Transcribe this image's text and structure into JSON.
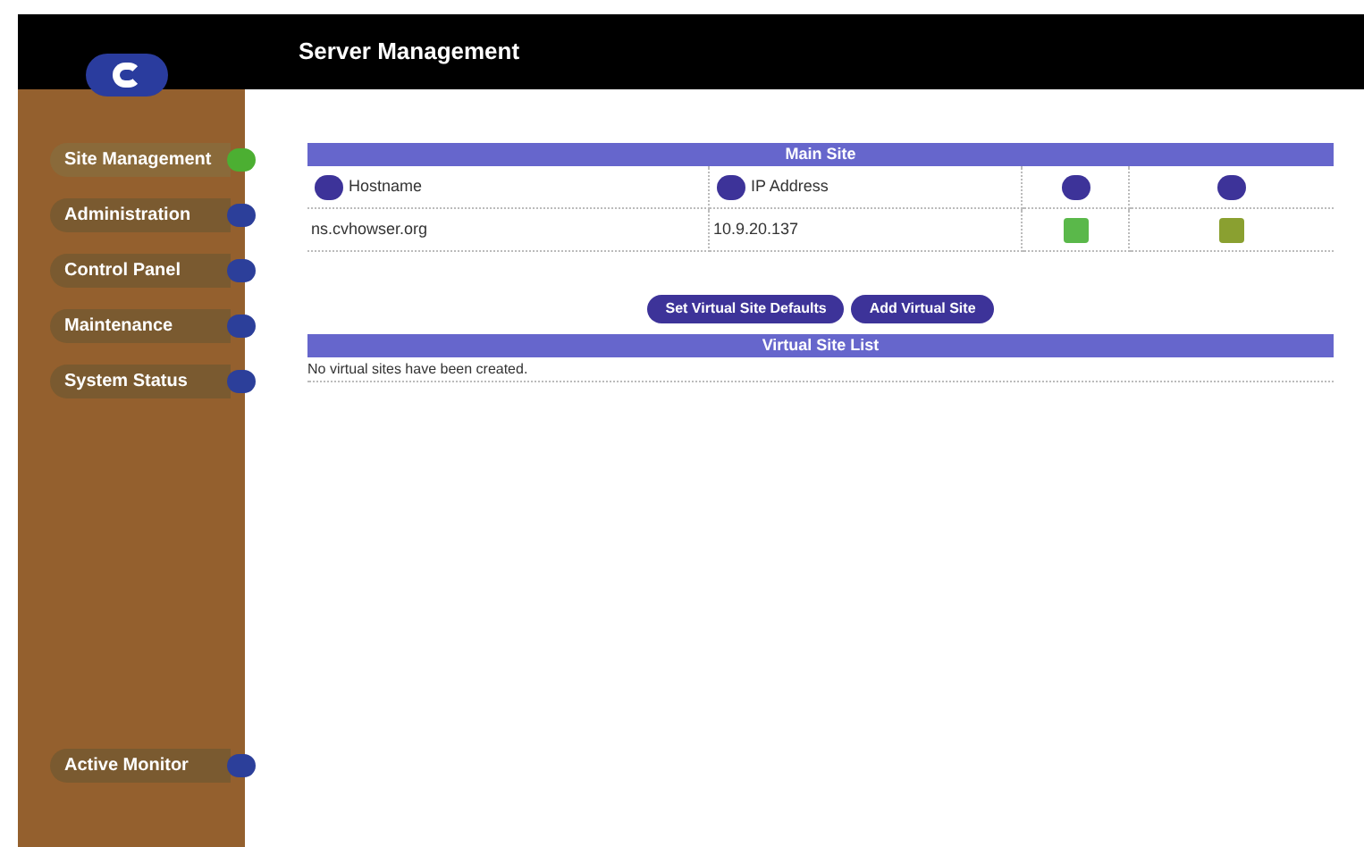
{
  "header": {
    "title": "Server Management"
  },
  "sidebar": {
    "items": [
      {
        "label": "Site Management",
        "selected": true
      },
      {
        "label": "Administration",
        "selected": false
      },
      {
        "label": "Control Panel",
        "selected": false
      },
      {
        "label": "Maintenance",
        "selected": false
      },
      {
        "label": "System Status",
        "selected": false
      }
    ],
    "bottom_item": {
      "label": "Active Monitor",
      "selected": false
    }
  },
  "main_site": {
    "title": "Main Site",
    "columns": [
      "Hostname",
      "IP Address"
    ],
    "rows": [
      {
        "hostname": "ns.cvhowser.org",
        "ip": "10.9.20.137"
      }
    ]
  },
  "buttons": [
    "Set Virtual Site Defaults",
    "Add Virtual Site"
  ],
  "virtual_sites": {
    "title": "Virtual Site List",
    "empty_message": "No virtual sites have been created."
  }
}
